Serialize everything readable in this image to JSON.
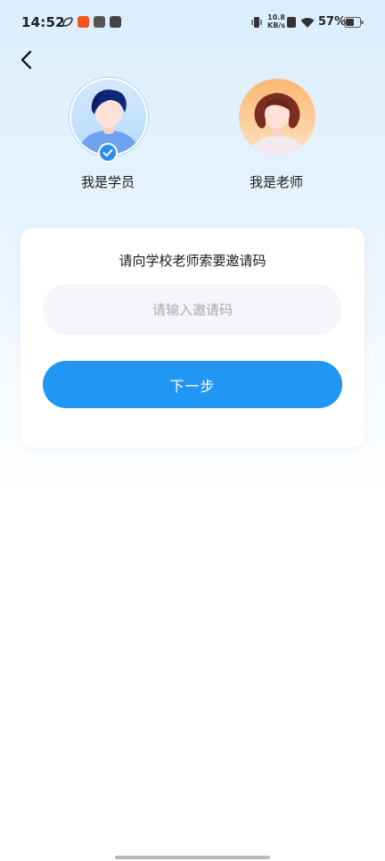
{
  "status_bar": {
    "time": "14:52",
    "net_speed_value": "10.8",
    "net_speed_unit": "KB/s",
    "battery": "57%",
    "icons": [
      "leaf-icon",
      "taobao-icon",
      "pill-icon",
      "mail-icon",
      "vibrate-icon",
      "no-sim-icon",
      "wifi-icon",
      "battery-icon"
    ]
  },
  "header": {
    "back_icon": "chevron-left-icon"
  },
  "roles": [
    {
      "label": "我是学员",
      "selected": true
    },
    {
      "label": "我是老师",
      "selected": false
    }
  ],
  "card": {
    "title": "请向学校老师索要邀请码",
    "input_placeholder": "请输入邀请码",
    "input_value": "",
    "next_label": "下一步"
  },
  "colors": {
    "accent": "#2196f3",
    "input_bg": "#f5f6f9",
    "placeholder": "#a8a9ad",
    "background_top": "#dbeefc"
  }
}
